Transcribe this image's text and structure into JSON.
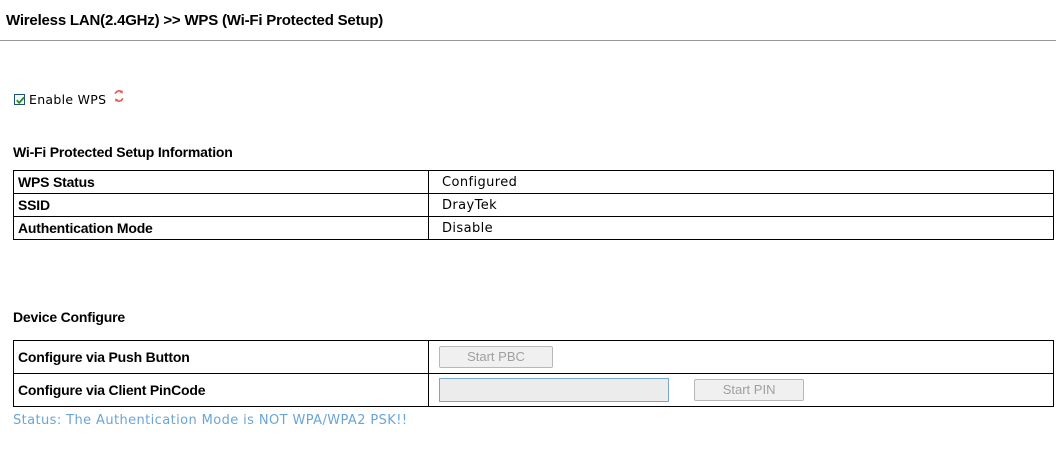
{
  "page": {
    "title": "Wireless LAN(2.4GHz) >> WPS (Wi-Fi Protected Setup)"
  },
  "enable_wps": {
    "label": "Enable WPS",
    "checked": true,
    "icon": "refresh-icon"
  },
  "info": {
    "heading": "Wi-Fi Protected Setup Information",
    "rows": [
      {
        "label": "WPS Status",
        "value": "Configured"
      },
      {
        "label": "SSID",
        "value": "DrayTek"
      },
      {
        "label": "Authentication Mode",
        "value": "Disable"
      }
    ]
  },
  "device": {
    "heading": "Device Configure",
    "push_button_label": "Configure via Push Button",
    "start_pbc": "Start PBC",
    "pincode_label": "Configure via Client PinCode",
    "pincode_value": "",
    "start_pin": "Start PIN"
  },
  "status": {
    "text": "Status: The Authentication Mode is NOT WPA/WPA2 PSK!!",
    "color": "#6aa5d8"
  },
  "colors": {
    "refresh_icon": "#e05a4a",
    "checkbox_tick": "#1f8f1f",
    "disabled_text": "#a0a0a0"
  }
}
